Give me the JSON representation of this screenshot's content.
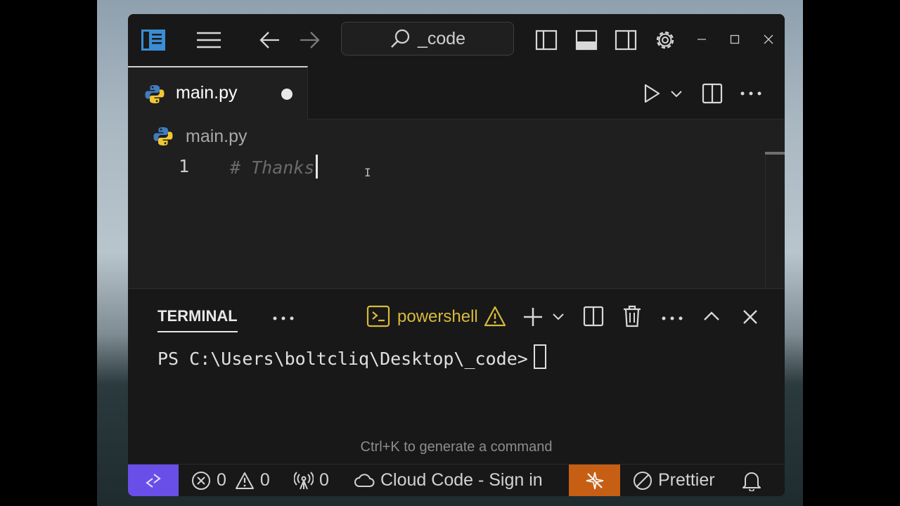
{
  "search": {
    "label": "_code"
  },
  "editor": {
    "tab": {
      "filename": "main.py"
    },
    "breadcrumb": "main.py",
    "lines": [
      {
        "number": "1",
        "text": "# Thanks"
      }
    ]
  },
  "panel": {
    "tab_label": "TERMINAL",
    "shell_label": "powershell",
    "prompt": "PS C:\\Users\\boltcliq\\Desktop\\_code>",
    "hint": "Ctrl+K to generate a command"
  },
  "statusbar": {
    "errors": "0",
    "warnings": "0",
    "ports": "0",
    "cloud_code": "Cloud Code - Sign in",
    "prettier": "Prettier"
  },
  "colors": {
    "remote_bg": "#6a4ee8",
    "extension_bg": "#c65f13",
    "shell_warning": "#d7ba3b",
    "python_blue": "#3f7cc0",
    "python_yellow": "#f2c832"
  },
  "icons": [
    "sidebar-toggle-icon",
    "menu-icon",
    "arrow-left-icon",
    "arrow-right-icon",
    "search-icon",
    "layout-left-icon",
    "layout-bottom-icon",
    "layout-right-icon",
    "gear-icon",
    "minimize-icon",
    "maximize-icon",
    "close-icon",
    "python-icon",
    "run-icon",
    "chevron-down-icon",
    "split-editor-icon",
    "more-icon",
    "terminal-icon",
    "warning-icon",
    "plus-icon",
    "trash-icon",
    "chevron-up-icon",
    "remote-icon",
    "error-icon",
    "broadcast-icon",
    "cloud-icon",
    "bell-icon"
  ]
}
